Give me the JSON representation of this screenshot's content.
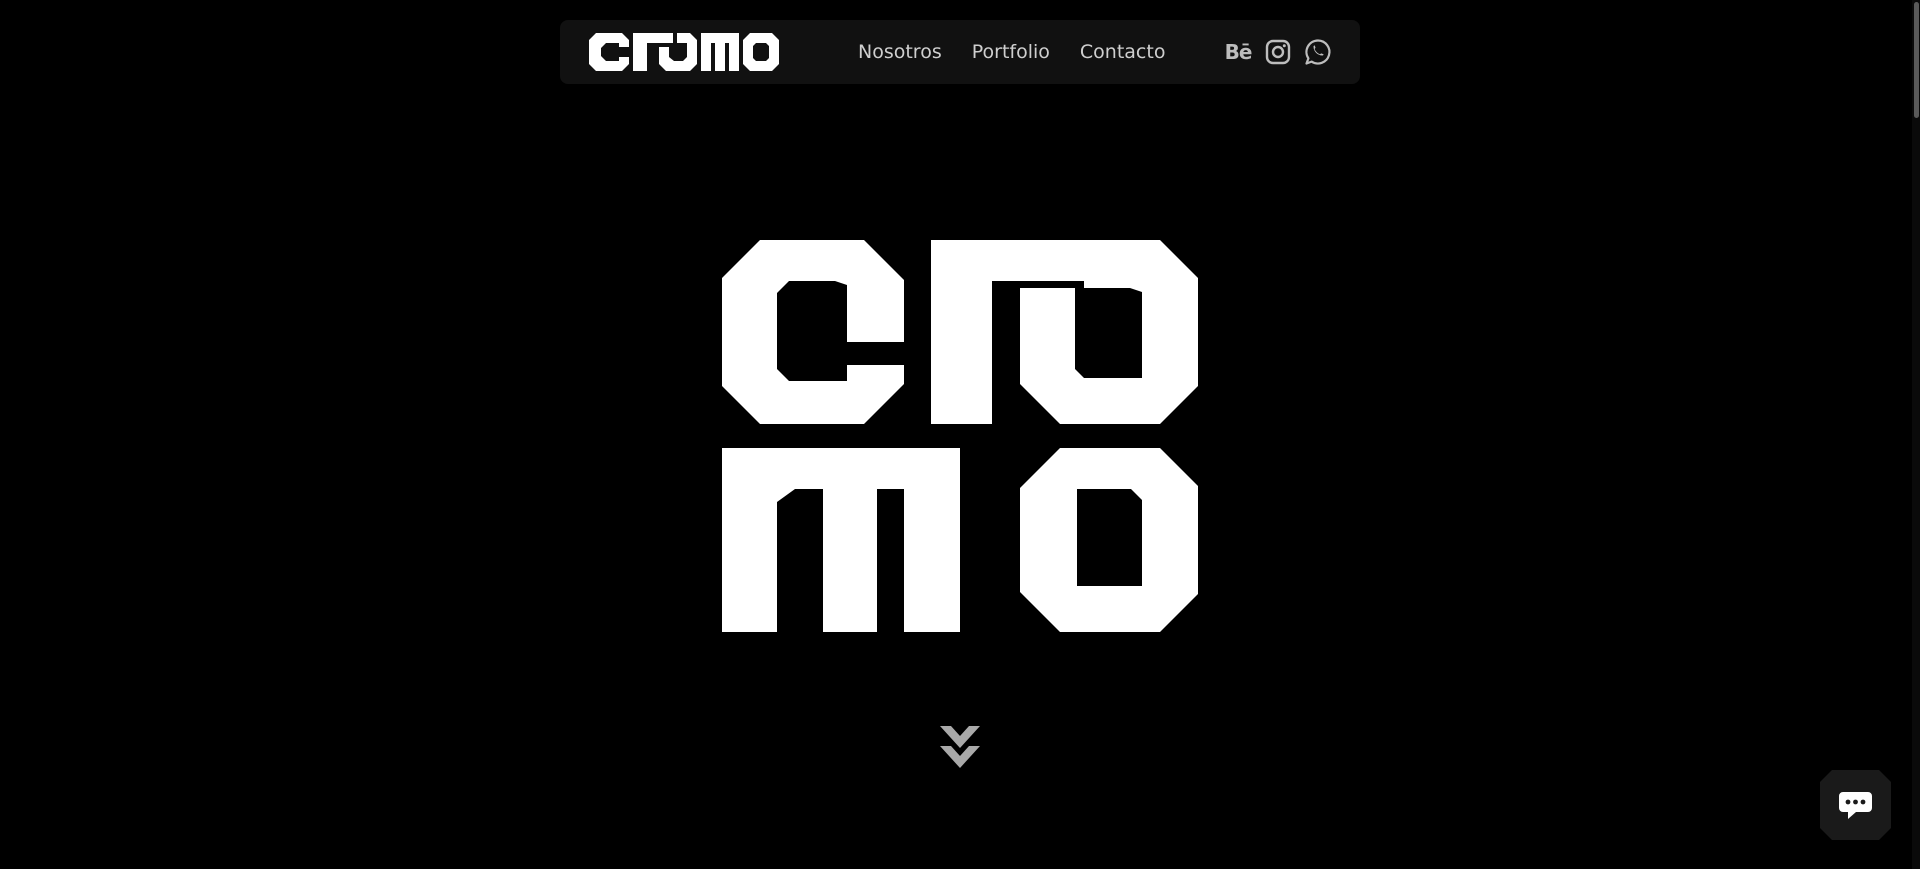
{
  "brand": {
    "name": "cromo",
    "nav_logo_icon": "cromo-wordmark-logo",
    "hero_logo_icon": "cromo-stacked-logo",
    "color": "#ffffff"
  },
  "nav": {
    "links": [
      {
        "label": "Nosotros"
      },
      {
        "label": "Portfolio"
      },
      {
        "label": "Contacto"
      }
    ],
    "social": [
      {
        "name": "behance-icon",
        "label": "Bē"
      },
      {
        "name": "instagram-icon"
      },
      {
        "name": "whatsapp-icon"
      }
    ]
  },
  "scroll_indicator": {
    "icon": "double-chevron-down-icon"
  },
  "chat": {
    "icon": "chat-bubble-icon"
  },
  "colors": {
    "background": "#000000",
    "navbar": "#111111",
    "nav_text": "#cfcfcf",
    "icon": "#bdbdbd",
    "chat_bg": "#1a1a1a"
  }
}
